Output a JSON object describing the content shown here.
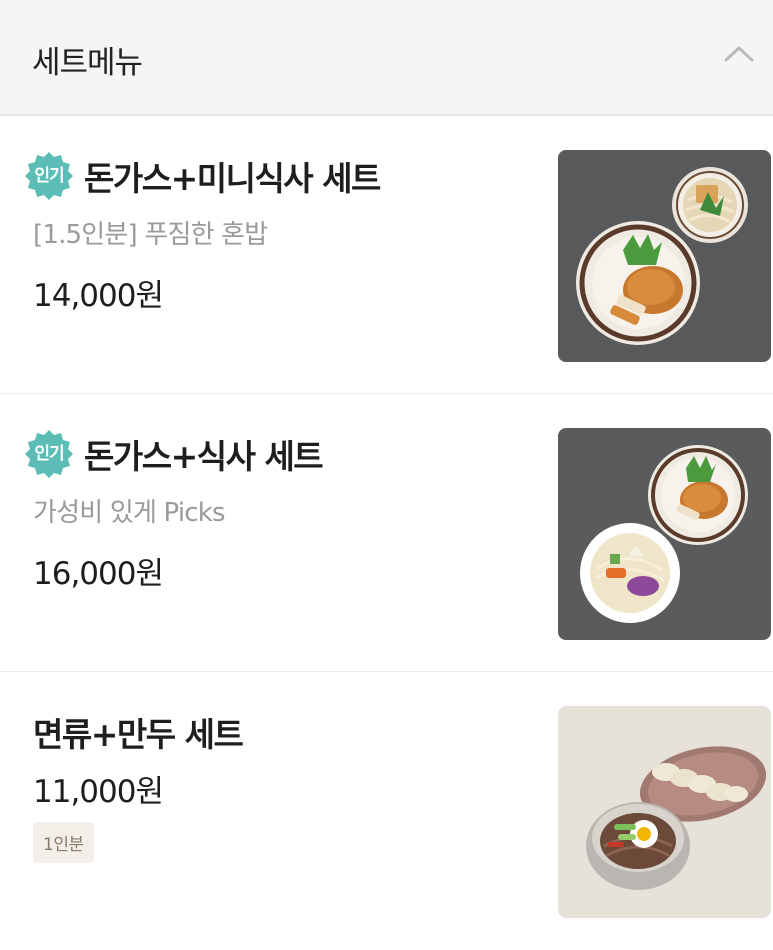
{
  "header": {
    "title": "세트메뉴",
    "collapse_icon": "chevron-up-icon"
  },
  "menu": {
    "items": [
      {
        "badge": "인기",
        "name": "돈가스+미니식사 세트",
        "description": "[1.5인분] 푸짐한 혼밥",
        "price": "14,000원",
        "image": "pork-cutlet-mini-meal-photo"
      },
      {
        "badge": "인기",
        "name": "돈가스+식사 세트",
        "description": "가성비 있게 Picks",
        "price": "16,000원",
        "image": "pork-cutlet-meal-photo"
      },
      {
        "name": "면류+만두 세트",
        "price": "11,000원",
        "portion": "1인분",
        "image": "noodles-dumplings-photo"
      }
    ]
  },
  "colors": {
    "badge": "#5bbdb6",
    "header_bg": "#f5f5f5",
    "price": "#1e1e1e",
    "description": "#9a9a9a"
  }
}
